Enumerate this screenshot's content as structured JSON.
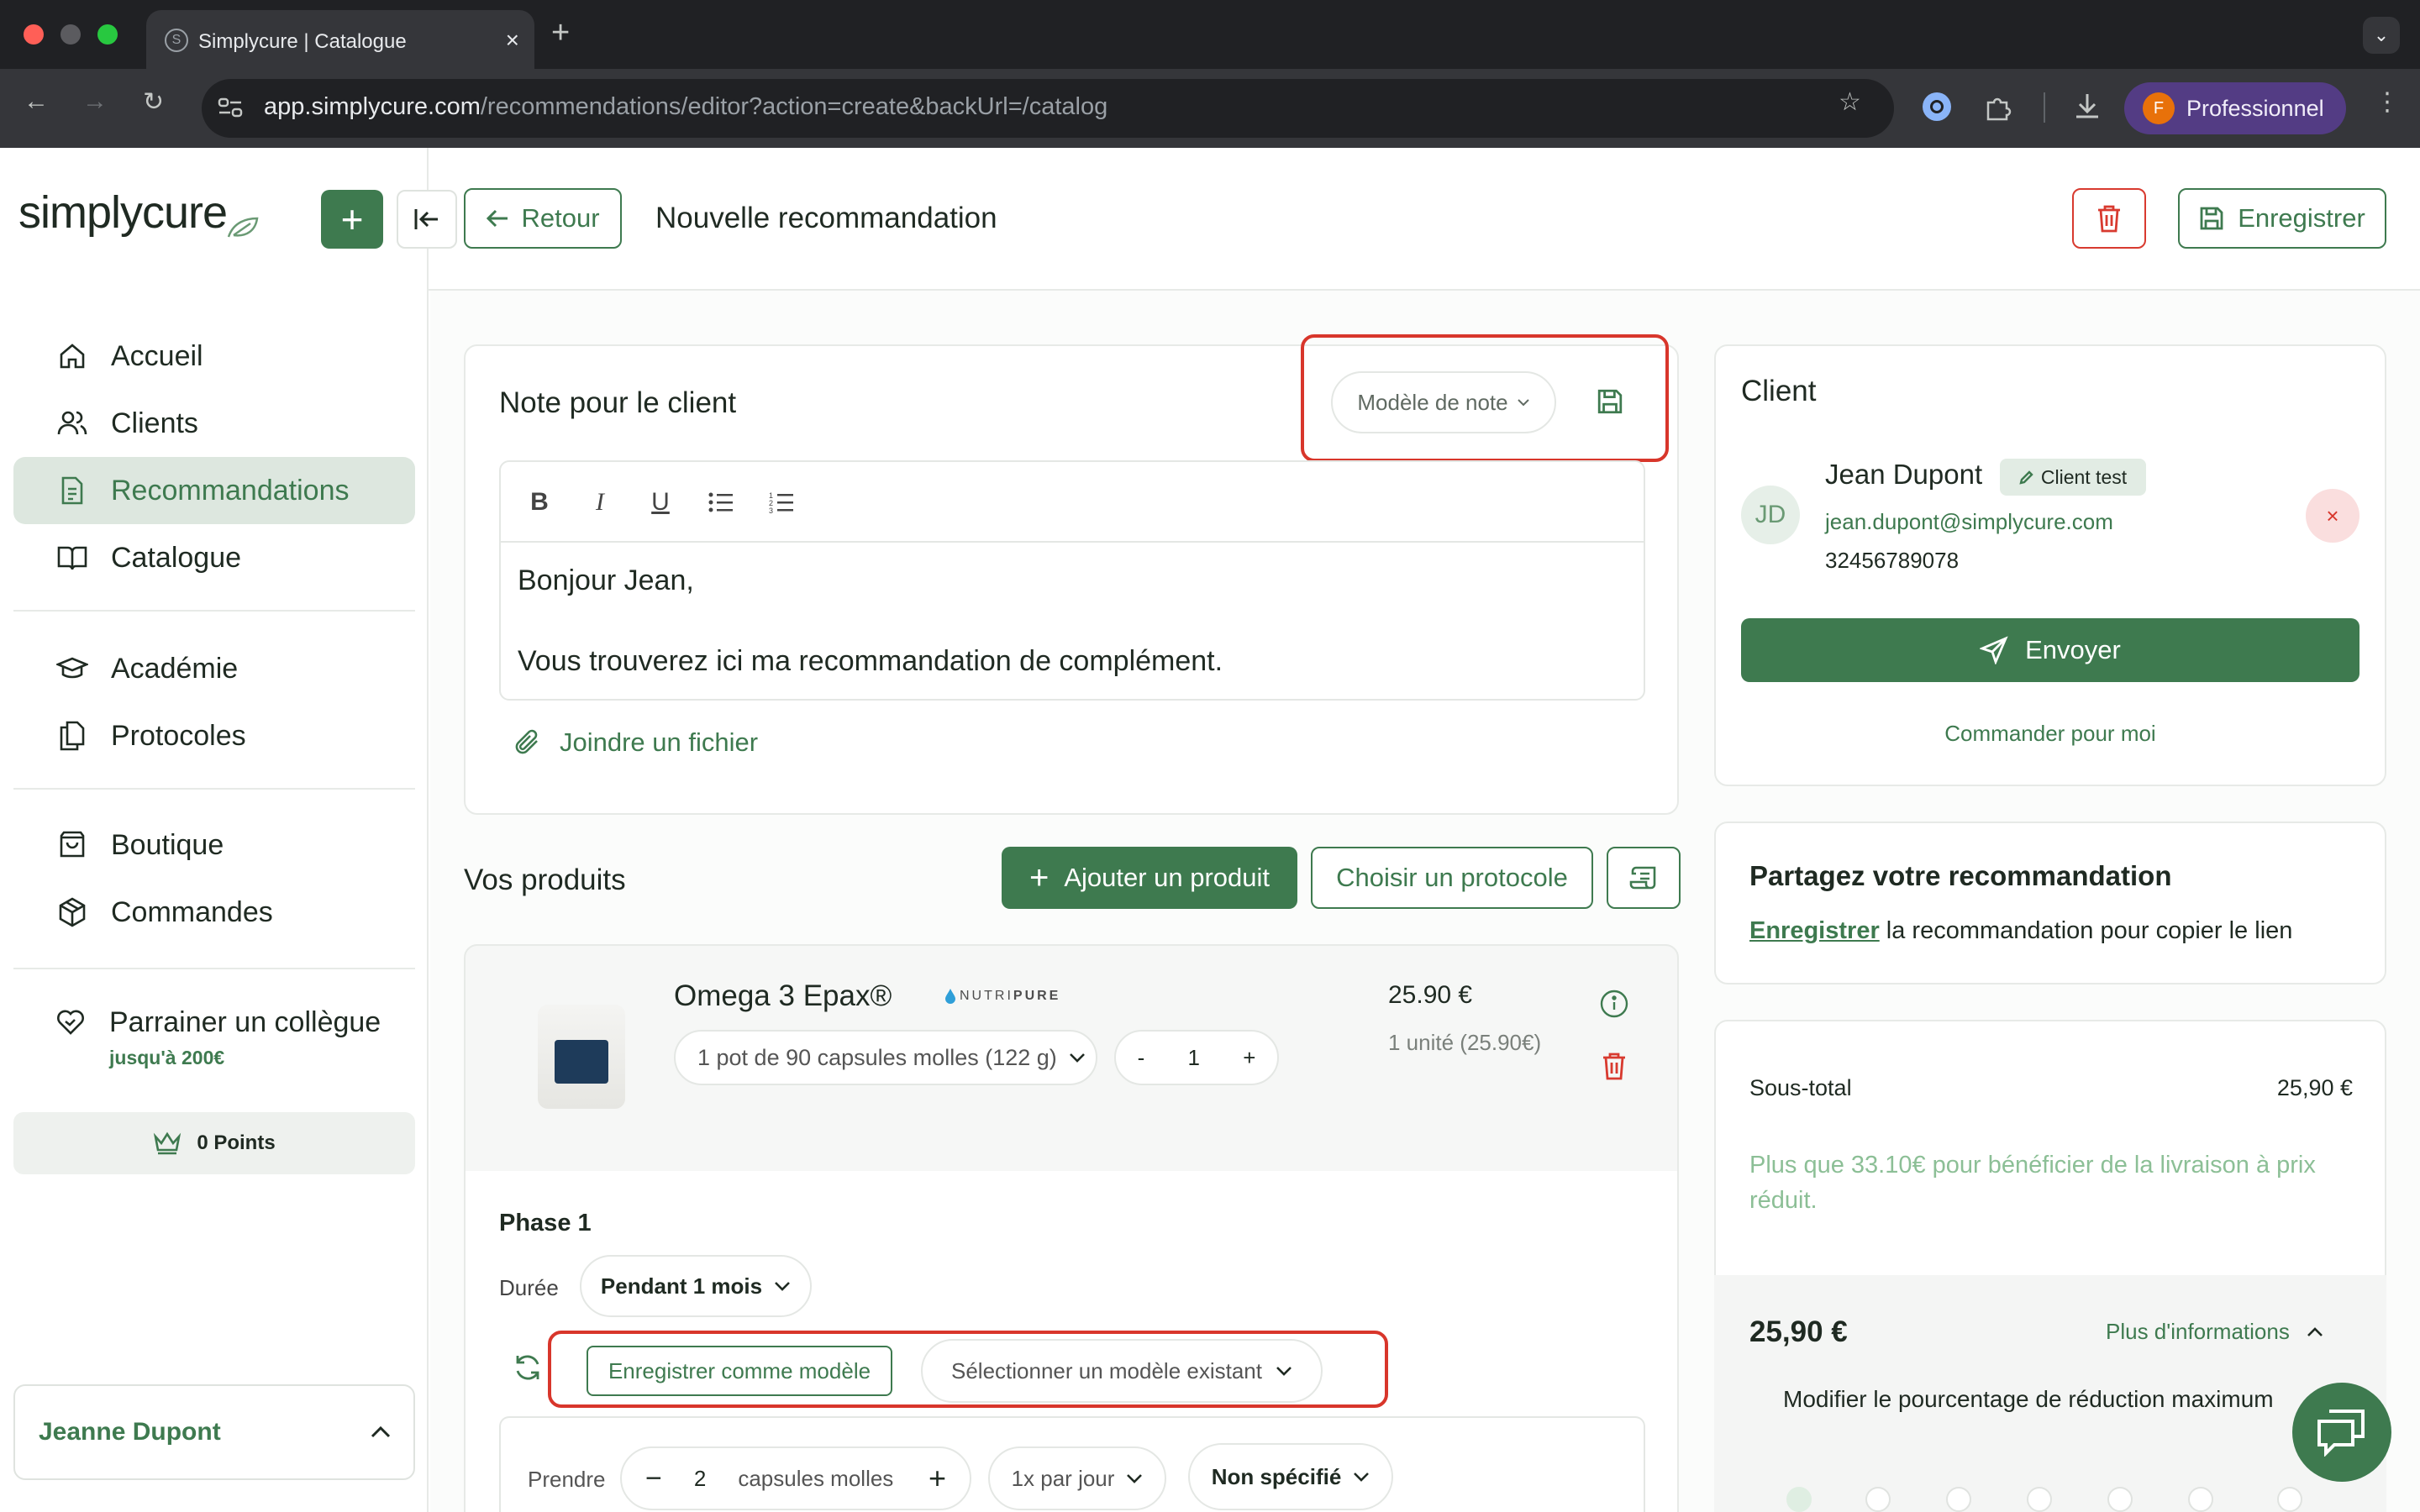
{
  "browser": {
    "tab_title": "Simplycure | Catalogue",
    "tab_favicon": "S",
    "url_host": "app.simplycure.com",
    "url_path": "/recommendations/editor?action=create&backUrl=/catalog",
    "profile_initial": "F",
    "profile_label": "Professionnel"
  },
  "sidebar": {
    "logo": "simplycure",
    "items": [
      {
        "label": "Accueil",
        "icon": "home-icon"
      },
      {
        "label": "Clients",
        "icon": "users-icon"
      },
      {
        "label": "Recommandations",
        "icon": "document-icon",
        "active": true
      },
      {
        "label": "Catalogue",
        "icon": "book-icon"
      },
      {
        "label": "Académie",
        "icon": "graduation-cap-icon"
      },
      {
        "label": "Protocoles",
        "icon": "files-icon"
      },
      {
        "label": "Boutique",
        "icon": "shopping-bag-icon"
      },
      {
        "label": "Commandes",
        "icon": "package-icon"
      }
    ],
    "referral_label": "Parrainer un collègue",
    "referral_sub": "jusqu'à 200€",
    "points": "0 Points",
    "user_name": "Jeanne Dupont"
  },
  "header": {
    "back_label": "Retour",
    "title": "Nouvelle recommandation",
    "save_label": "Enregistrer"
  },
  "note": {
    "title": "Note pour le client",
    "template_select": "Modèle de note",
    "line1": "Bonjour Jean,",
    "line2": "Vous trouverez ici ma recommandation de complément.",
    "attach_label": "Joindre un fichier"
  },
  "products": {
    "title": "Vos produits",
    "add_label": "Ajouter un produit",
    "protocol_label": "Choisir un protocole",
    "item": {
      "name": "Omega 3 Epax®",
      "brand_a": "NUTRI",
      "brand_b": "PURE",
      "variant": "1 pot de 90 capsules molles (122 g)",
      "qty_minus": "-",
      "quantity": "1",
      "qty_plus": "+",
      "price": "25.90 €",
      "unit_price": "1 unité (25.90€)"
    },
    "phase": {
      "title": "Phase 1",
      "duration_label": "Durée",
      "duration_value": "Pendant 1 mois",
      "save_template": "Enregistrer comme modèle",
      "select_template": "Sélectionner un modèle existant",
      "take_label": "Prendre",
      "take_qty": "2",
      "take_unit": "capsules molles",
      "frequency": "1x par jour",
      "timing": "Non spécifié"
    }
  },
  "client": {
    "title": "Client",
    "initials": "JD",
    "name": "Jean Dupont",
    "badge": "Client test",
    "email": "jean.dupont@simplycure.com",
    "phone": "32456789078",
    "send_label": "Envoyer",
    "order_label": "Commander pour moi"
  },
  "share": {
    "title": "Partagez votre recommandation",
    "link_word": "Enregistrer",
    "text": " la recommandation pour copier le lien"
  },
  "summary": {
    "subtotal_label": "Sous-total",
    "subtotal_value": "25,90 €",
    "shipping_note": "Plus que 33.10€ pour bénéficier de la livraison à prix réduit.",
    "total": "25,90 €",
    "more_info": "Plus d'informations",
    "discount_label": "Modifier le pourcentage de réduction maximum"
  },
  "colors": {
    "brand_green": "#3e7a4f",
    "highlight_red": "#d8362b",
    "danger_red": "#d83a2f"
  }
}
